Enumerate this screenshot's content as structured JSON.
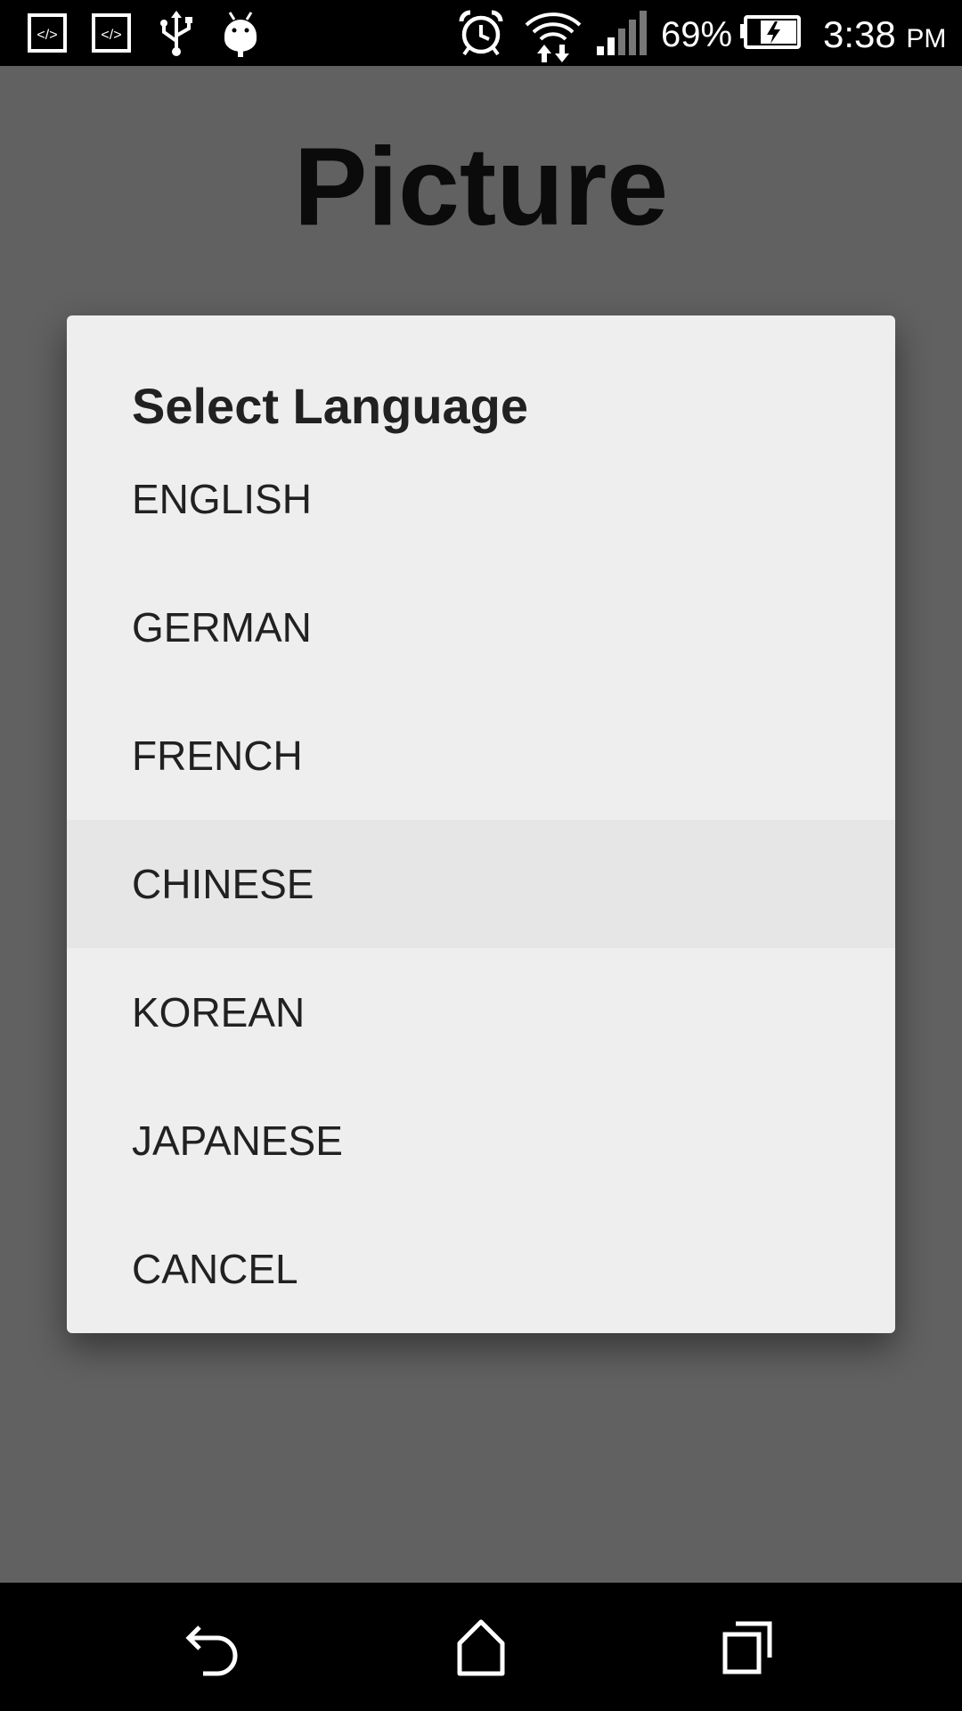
{
  "status_bar": {
    "icons": [
      "code-icon",
      "code-icon",
      "usb-icon",
      "android-debug-icon",
      "alarm-icon",
      "wifi-icon",
      "signal-icon",
      "battery-charging-icon"
    ],
    "battery_percent": "69%",
    "time": "3:38",
    "ampm": "PM"
  },
  "app": {
    "title": "Picture"
  },
  "dialog": {
    "title": "Select Language",
    "options": [
      {
        "label": "ENGLISH"
      },
      {
        "label": "GERMAN"
      },
      {
        "label": "FRENCH"
      },
      {
        "label": "CHINESE"
      },
      {
        "label": "KOREAN"
      },
      {
        "label": "JAPANESE"
      },
      {
        "label": "CANCEL"
      }
    ]
  },
  "nav_bar": {
    "buttons": [
      "back-icon",
      "home-icon",
      "recents-icon"
    ]
  },
  "colors": {
    "scrim_background": "#616161",
    "dialog_background": "#eeeeee",
    "pressed_row": "#e6e6e6",
    "text": "#212121",
    "system_bars": "#000000"
  }
}
